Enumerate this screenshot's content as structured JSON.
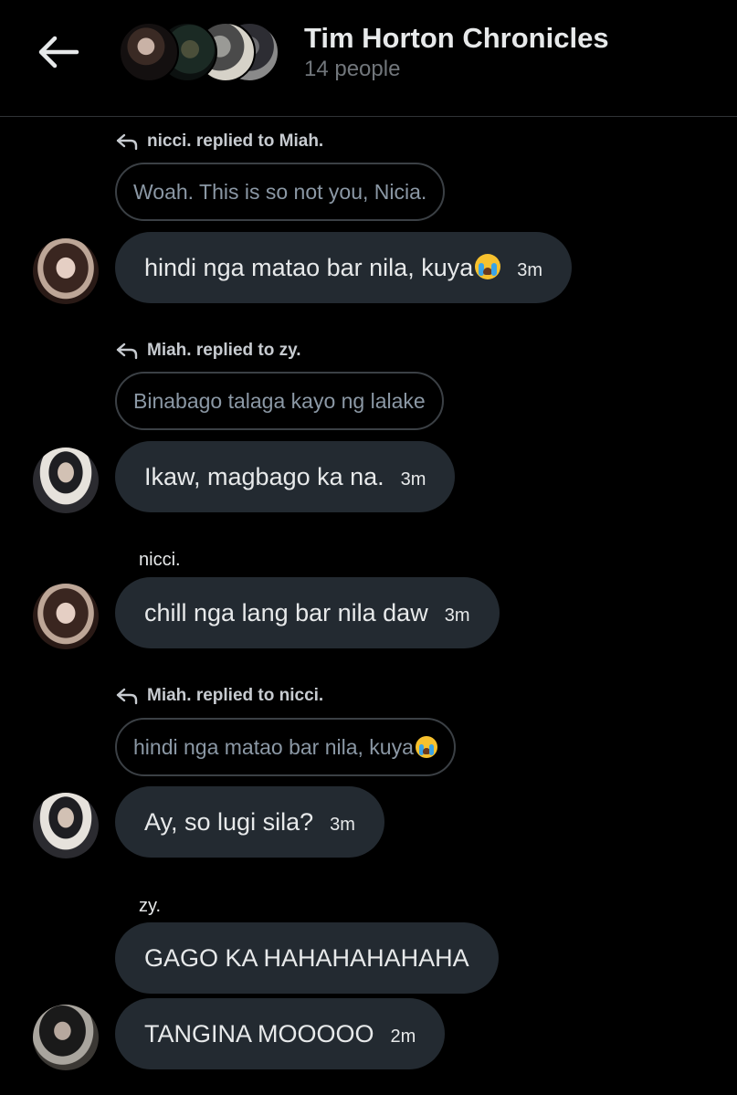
{
  "header": {
    "title": "Tim Horton Chronicles",
    "subtitle": "14 people",
    "icons": [
      "back-arrow-icon"
    ]
  },
  "messages": [
    {
      "reply_label": "nicci. replied to Miah.",
      "quote": "Woah. This is so not you, Nicia.",
      "text": "hindi nga matao bar nila, kuya",
      "emoji": "loudly-crying-face",
      "time": "3m",
      "avatar": "nicci"
    },
    {
      "reply_label": "Miah. replied to zy.",
      "quote": "Binabago talaga kayo ng lalake",
      "text": "Ikaw, magbago ka na.",
      "time": "3m",
      "avatar": "Miah."
    },
    {
      "sender": "nicci.",
      "text": "chill nga lang bar nila daw",
      "time": "3m",
      "avatar": "nicci"
    },
    {
      "reply_label": "Miah. replied to nicci.",
      "quote": "hindi nga matao bar nila, kuya",
      "quote_emoji": "loudly-crying-face",
      "text": "Ay, so lugi sila?",
      "time": "3m",
      "avatar": "Miah."
    },
    {
      "sender": "zy.",
      "text": "GAGO KA HAHAHAHAHAHA",
      "avatar": "zy."
    },
    {
      "text": "TANGINA MOOOOO",
      "time": "2m",
      "avatar": "zy."
    }
  ],
  "colors": {
    "background": "#000000",
    "bubble": "#232a31",
    "text": "#e7e9ea",
    "muted": "#71767b",
    "quote_border": "#3b4045"
  }
}
